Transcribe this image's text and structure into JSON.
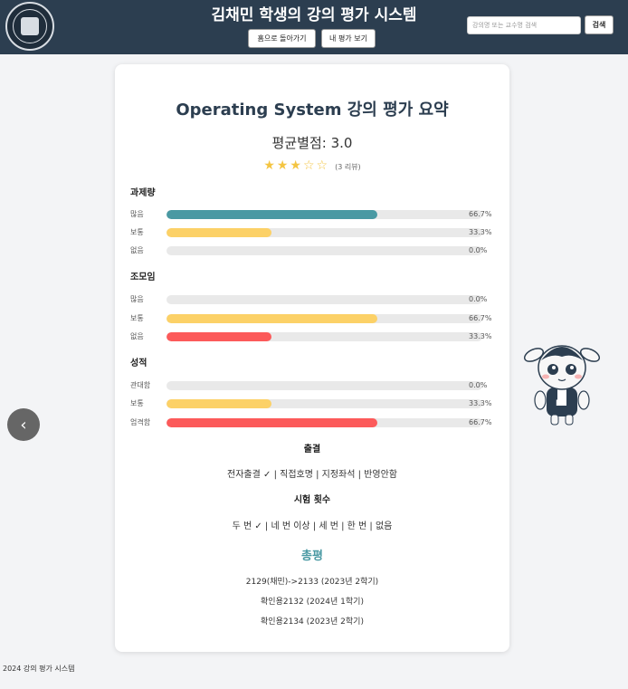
{
  "header": {
    "title": "김채민 학생의 강의 평가 시스템",
    "home_button": "홈으로 돌아가기",
    "my_reviews_button": "내 평가 보기",
    "search_placeholder": "강의명 또는 교수명 검색",
    "search_button": "검색",
    "logo_icon": "university-seal-icon"
  },
  "summary": {
    "title": "Operating System 강의 평가 요약",
    "average": "평균별점: 3.0",
    "stars_display": "★★★☆☆",
    "rating": 3,
    "max_rating": 5,
    "review_count": "(3 리뷰)"
  },
  "sections": [
    {
      "title": "과제량",
      "rows": [
        {
          "label": "많음",
          "percent": "66.7%",
          "value": 66.7,
          "color": "#4a99a3"
        },
        {
          "label": "보통",
          "percent": "33.3%",
          "value": 33.3,
          "color": "#fcd167"
        },
        {
          "label": "없음",
          "percent": "0.0%",
          "value": 0.0,
          "color": "#fcd167"
        }
      ]
    },
    {
      "title": "조모임",
      "rows": [
        {
          "label": "많음",
          "percent": "0.0%",
          "value": 0.0,
          "color": "#4a99a3"
        },
        {
          "label": "보통",
          "percent": "66.7%",
          "value": 66.7,
          "color": "#fcd167"
        },
        {
          "label": "없음",
          "percent": "33.3%",
          "value": 33.3,
          "color": "#fc5a5a"
        }
      ]
    },
    {
      "title": "성적",
      "rows": [
        {
          "label": "관대함",
          "percent": "0.0%",
          "value": 0.0,
          "color": "#4a99a3"
        },
        {
          "label": "보통",
          "percent": "33.3%",
          "value": 33.3,
          "color": "#fcd167"
        },
        {
          "label": "엄격함",
          "percent": "66.7%",
          "value": 66.7,
          "color": "#fc5a5a"
        }
      ]
    }
  ],
  "attendance": {
    "title": "출결",
    "options": "전자출결 ✓ | 직접호명 | 지정좌석 | 반영안함"
  },
  "exams": {
    "title": "시험 횟수",
    "options": "두 번 ✓ | 네 번 이상 | 세 번 | 한 번 | 없음"
  },
  "reviews": {
    "title": "총평",
    "items": [
      "2129(채민)->2133 (2023년 2학기)",
      "확인용2132 (2024년 1학기)",
      "확인용2134 (2023년 2학기)"
    ]
  },
  "prev_icon": "‹",
  "mascot_icon": "mascot-character-icon",
  "footer": "2024 강의 평가 시스템"
}
